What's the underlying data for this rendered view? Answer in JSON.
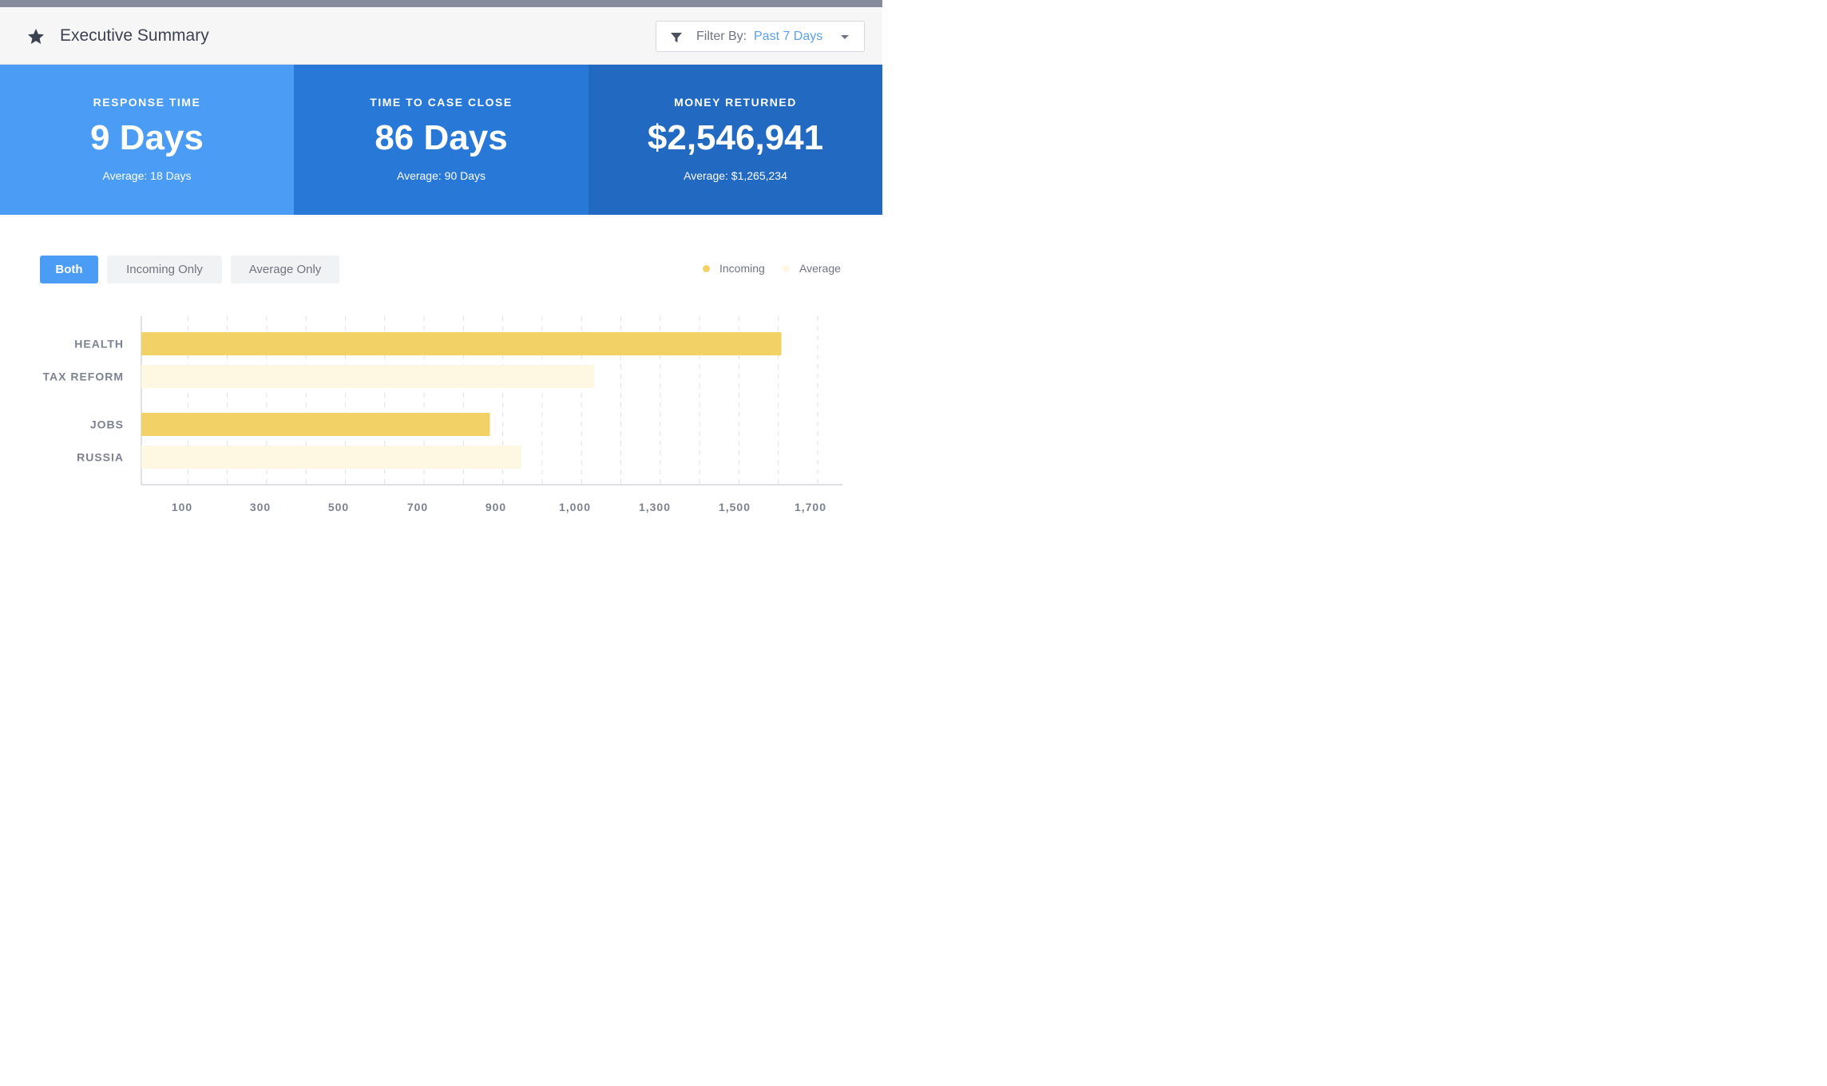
{
  "header": {
    "title": "Executive Summary",
    "star_icon": "star-icon",
    "filter": {
      "label": "Filter By:",
      "value": "Past 7 Days",
      "icon": "filter-icon"
    }
  },
  "kpis": [
    {
      "label": "RESPONSE TIME",
      "value": "9 Days",
      "average": "Average: 18 Days",
      "color": "#4b9cf5"
    },
    {
      "label": "TIME TO CASE CLOSE",
      "value": "86 Days",
      "average": "Average: 90 Days",
      "color": "#2878d8"
    },
    {
      "label": "MONEY RETURNED",
      "value": "$2,546,941",
      "average": "Average: $1,265,234",
      "color": "#2169c1"
    }
  ],
  "toggle": {
    "both": "Both",
    "incoming": "Incoming Only",
    "average": "Average Only",
    "active": "Both"
  },
  "legend": {
    "incoming": {
      "label": "Incoming",
      "color": "#f2d266"
    },
    "average": {
      "label": "Average",
      "color": "#fef7e1"
    }
  },
  "chart_data": {
    "type": "bar",
    "orientation": "horizontal",
    "categories": [
      "HEALTH",
      "TAX REFORM",
      "JOBS",
      "RUSSIA"
    ],
    "values": [
      1625,
      1150,
      885,
      965
    ],
    "bar_series": [
      "Incoming",
      "Average",
      "Incoming",
      "Average"
    ],
    "x_ticks": [
      "100",
      "300",
      "500",
      "700",
      "900",
      "1,000",
      "1,300",
      "1,500",
      "1,700"
    ],
    "xlim": [
      0,
      1780
    ],
    "grid": "vertical-dashed",
    "legend_position": "top-right"
  }
}
